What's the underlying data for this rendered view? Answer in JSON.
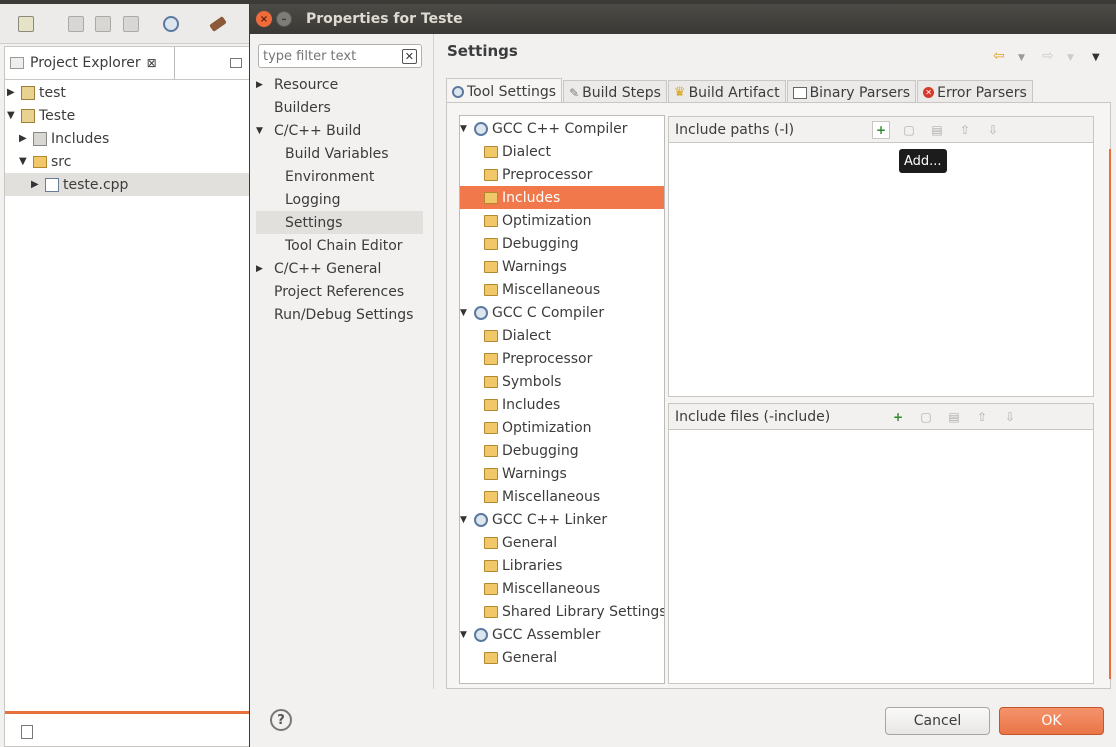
{
  "explorer": {
    "tab_label": "Project Explorer",
    "close_glyph": "⊠",
    "items": [
      {
        "label": "test",
        "level": 0,
        "expanded": false
      },
      {
        "label": "Teste",
        "level": 0,
        "expanded": true
      },
      {
        "label": "Includes",
        "level": 1,
        "expanded": false
      },
      {
        "label": "src",
        "level": 1,
        "expanded": true
      },
      {
        "label": "teste.cpp",
        "level": 2,
        "expanded": false
      }
    ]
  },
  "dialog": {
    "title": "Properties for Teste",
    "filter_placeholder": "type filter text",
    "nav": [
      {
        "label": "Resource",
        "has_arrow": true
      },
      {
        "label": "Builders"
      },
      {
        "label": "C/C++ Build",
        "expanded": true
      },
      {
        "label": "Build Variables",
        "child": true
      },
      {
        "label": "Environment",
        "child": true
      },
      {
        "label": "Logging",
        "child": true
      },
      {
        "label": "Settings",
        "child": true,
        "selected": true
      },
      {
        "label": "Tool Chain Editor",
        "child": true
      },
      {
        "label": "C/C++ General",
        "has_arrow": true
      },
      {
        "label": "Project References"
      },
      {
        "label": "Run/Debug Settings"
      }
    ],
    "page_title": "Settings",
    "tabs": [
      "Tool Settings",
      "Build Steps",
      "Build Artifact",
      "Binary Parsers",
      "Error Parsers"
    ],
    "active_tab": "Tool Settings",
    "tool_tree": [
      {
        "label": "GCC C++ Compiler",
        "group": true
      },
      {
        "label": "Dialect"
      },
      {
        "label": "Preprocessor"
      },
      {
        "label": "Includes",
        "selected": true
      },
      {
        "label": "Optimization"
      },
      {
        "label": "Debugging"
      },
      {
        "label": "Warnings"
      },
      {
        "label": "Miscellaneous"
      },
      {
        "label": "GCC C Compiler",
        "group": true
      },
      {
        "label": "Dialect"
      },
      {
        "label": "Preprocessor"
      },
      {
        "label": "Symbols"
      },
      {
        "label": "Includes"
      },
      {
        "label": "Optimization"
      },
      {
        "label": "Debugging"
      },
      {
        "label": "Warnings"
      },
      {
        "label": "Miscellaneous"
      },
      {
        "label": "GCC C++ Linker",
        "group": true
      },
      {
        "label": "General"
      },
      {
        "label": "Libraries"
      },
      {
        "label": "Miscellaneous"
      },
      {
        "label": "Shared Library Settings"
      },
      {
        "label": "GCC Assembler",
        "group": true
      },
      {
        "label": "General"
      }
    ],
    "include_paths_label": "Include paths (-I)",
    "include_files_label": "Include files (-include)",
    "tooltip": "Add...",
    "help_glyph": "?",
    "cancel_label": "Cancel",
    "ok_label": "OK"
  },
  "colors": {
    "accent": "#e8703c",
    "selection": "#f0784a",
    "titlebar": "#3c3b37"
  }
}
